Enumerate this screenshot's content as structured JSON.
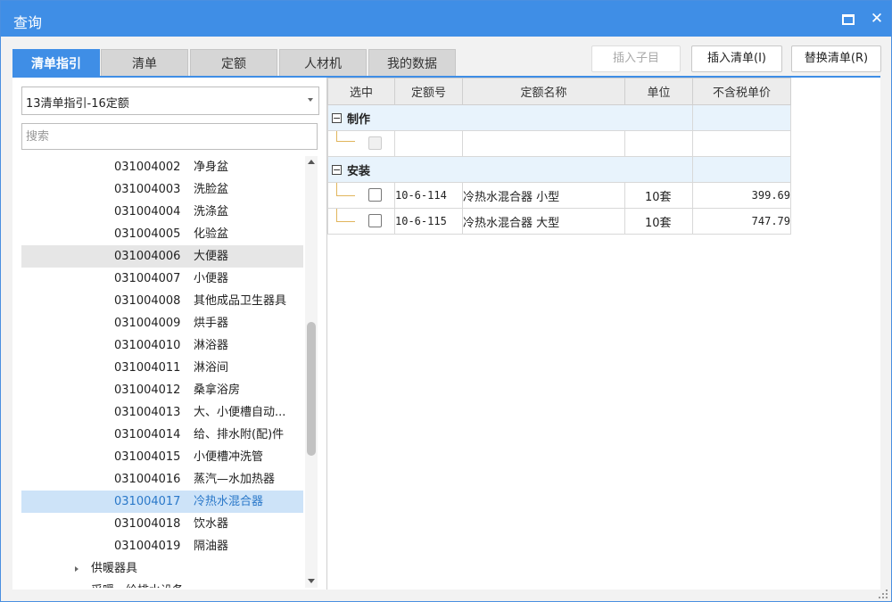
{
  "window": {
    "title": "查询",
    "maximize_icon": "maximize-icon",
    "close_icon": "close-icon",
    "close_glyph": "✕"
  },
  "tabs": [
    {
      "label": "清单指引",
      "active": true
    },
    {
      "label": "清单",
      "active": false
    },
    {
      "label": "定额",
      "active": false
    },
    {
      "label": "人材机",
      "active": false
    },
    {
      "label": "我的数据",
      "active": false
    }
  ],
  "actions": {
    "insert_child": "插入子目",
    "insert_list": "插入清单(I)",
    "replace_list": "替换清单(R)"
  },
  "left": {
    "combo_value": "13清单指引-16定额",
    "search_placeholder": "搜索",
    "items": [
      {
        "code": "031004002",
        "name": "净身盆"
      },
      {
        "code": "031004003",
        "name": "洗脸盆"
      },
      {
        "code": "031004004",
        "name": "洗涤盆"
      },
      {
        "code": "031004005",
        "name": "化验盆"
      },
      {
        "code": "031004006",
        "name": "大便器"
      },
      {
        "code": "031004007",
        "name": "小便器"
      },
      {
        "code": "031004008",
        "name": "其他成品卫生器具"
      },
      {
        "code": "031004009",
        "name": "烘手器"
      },
      {
        "code": "031004010",
        "name": "淋浴器"
      },
      {
        "code": "031004011",
        "name": "淋浴间"
      },
      {
        "code": "031004012",
        "name": "桑拿浴房"
      },
      {
        "code": "031004013",
        "name": "大、小便槽自动..."
      },
      {
        "code": "031004014",
        "name": "给、排水附(配)件"
      },
      {
        "code": "031004015",
        "name": "小便槽冲洗管"
      },
      {
        "code": "031004016",
        "name": "蒸汽—水加热器"
      },
      {
        "code": "031004017",
        "name": "冷热水混合器"
      },
      {
        "code": "031004018",
        "name": "饮水器"
      },
      {
        "code": "031004019",
        "name": "隔油器"
      }
    ],
    "groups": [
      {
        "name": "供暖器具"
      },
      {
        "name": "采暖、给排水设备"
      }
    ],
    "hover_code": "031004006",
    "selected_code": "031004017"
  },
  "grid": {
    "columns": {
      "select": "选中",
      "code": "定额号",
      "name": "定额名称",
      "unit": "单位",
      "price": "不含税单价"
    },
    "groups": [
      {
        "title": "制作",
        "toggle": "−",
        "rows": []
      },
      {
        "title": "安装",
        "toggle": "−",
        "rows": [
          {
            "code": "10-6-114",
            "name": "冷热水混合器 小型",
            "unit": "10套",
            "price": "399.69"
          },
          {
            "code": "10-6-115",
            "name": "冷热水混合器 大型",
            "unit": "10套",
            "price": "747.79"
          }
        ]
      }
    ]
  }
}
